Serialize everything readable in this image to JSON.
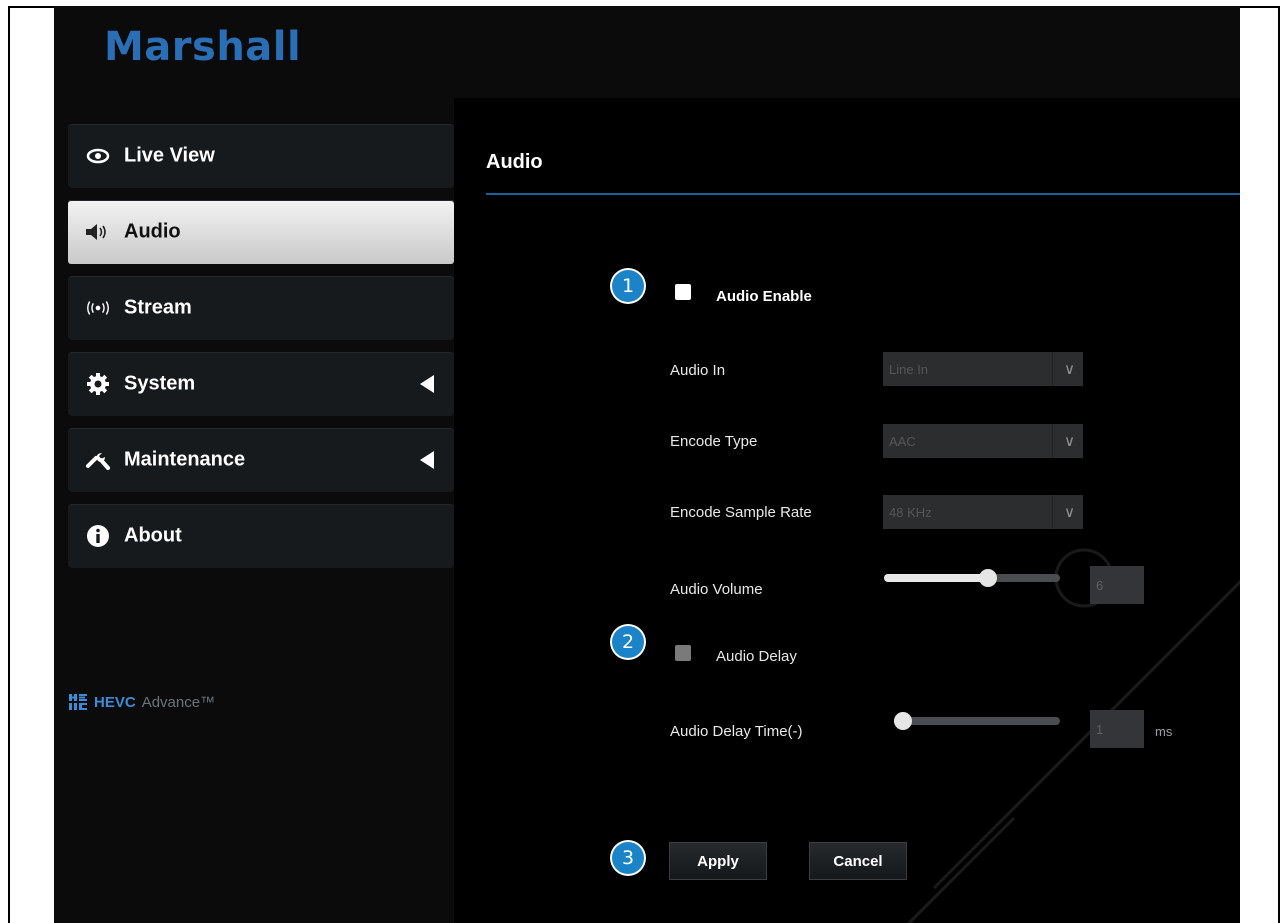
{
  "brand": {
    "logo_text": "Marshall"
  },
  "sidebar": {
    "items": [
      {
        "label": "Live View",
        "icon": "eye-icon"
      },
      {
        "label": "Audio",
        "icon": "speaker-icon",
        "active": true
      },
      {
        "label": "Stream",
        "icon": "broadcast-icon"
      },
      {
        "label": "System",
        "icon": "gear-icon",
        "has_submenu": true
      },
      {
        "label": "Maintenance",
        "icon": "wrench-icon",
        "has_submenu": true
      },
      {
        "label": "About",
        "icon": "info-icon"
      }
    ],
    "hevc_logo": {
      "main": "HEVC",
      "sub": "Advance™"
    }
  },
  "main": {
    "title": "Audio",
    "audio_enable": {
      "label": "Audio Enable",
      "checked": true
    },
    "audio_in": {
      "label": "Audio In",
      "value": "Line In"
    },
    "encode_type": {
      "label": "Encode Type",
      "value": "AAC"
    },
    "encode_sample_rate": {
      "label": "Encode Sample Rate",
      "value": "48 KHz"
    },
    "audio_volume": {
      "label": "Audio Volume",
      "value": "6",
      "level": 0.6
    },
    "audio_delay": {
      "label": "Audio Delay",
      "checked": false
    },
    "audio_delay_time": {
      "label": "Audio Delay Time(-)",
      "value": "1",
      "unit": "ms",
      "level": 0.0
    },
    "buttons": {
      "apply": "Apply",
      "cancel": "Cancel"
    }
  },
  "callouts": [
    "1",
    "2",
    "3"
  ],
  "colors": {
    "accent": "#1b84c8",
    "logo": "#2a6fb6",
    "rule": "#1e5f97",
    "background": "#0b0b0c"
  }
}
